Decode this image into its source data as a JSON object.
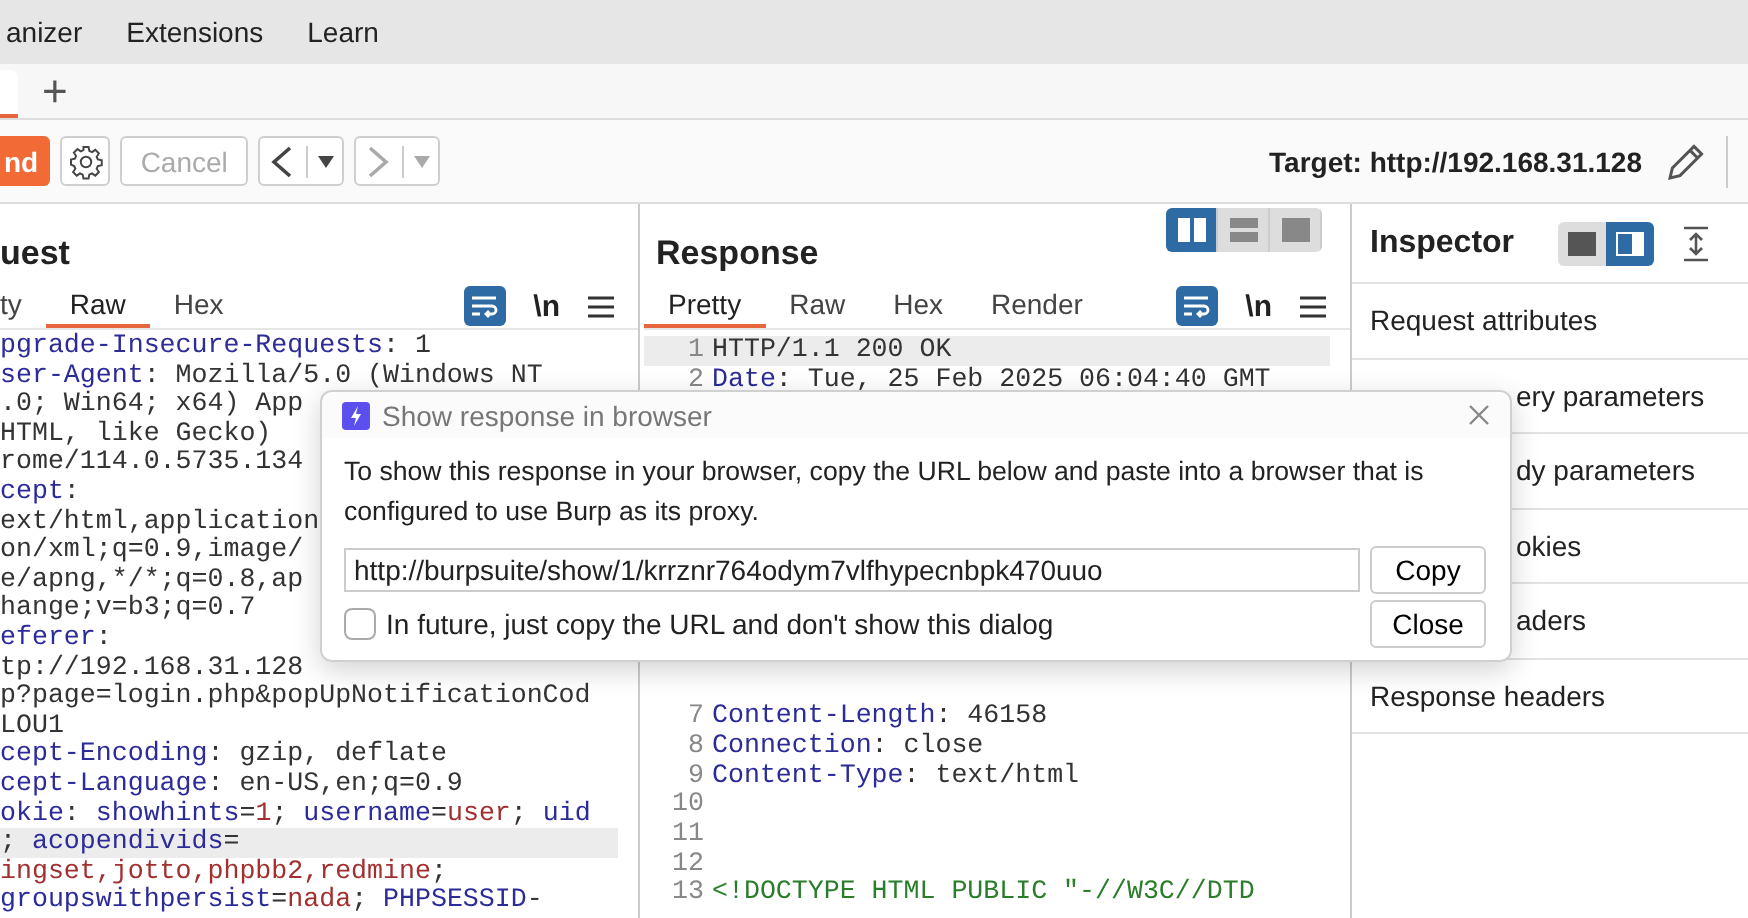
{
  "menu_bar": {
    "items": [
      "anizer",
      "Extensions",
      "Learn"
    ]
  },
  "tab_bar": {
    "add_label": "+"
  },
  "toolbar": {
    "send_label": "nd",
    "cancel": {
      "label": "Cancel",
      "disabled": true
    },
    "back": {
      "disabled": false
    },
    "forward": {
      "disabled": true
    },
    "target": "Target: http://192.168.31.128"
  },
  "request": {
    "title": "uest",
    "tabs": [
      {
        "label": "ty",
        "selected": false
      },
      {
        "label": "Raw",
        "selected": true
      },
      {
        "label": "Hex",
        "selected": false
      }
    ],
    "wrap": {
      "on": true
    },
    "newline_label": "\\n",
    "lines": [
      {
        "highlighted": false,
        "parts": [
          {
            "text": "pgrade-Insecure-Requests",
            "kind": "key"
          },
          {
            "text": ": 1",
            "kind": "plain"
          }
        ]
      },
      {
        "highlighted": false,
        "parts": [
          {
            "text": "ser-Agent",
            "kind": "key"
          },
          {
            "text": ": Mozilla/5.0 (Windows NT",
            "kind": "plain"
          }
        ]
      },
      {
        "highlighted": false,
        "parts": [
          {
            "text": ".0; Win64; x64) App",
            "kind": "plain"
          }
        ]
      },
      {
        "highlighted": false,
        "parts": [
          {
            "text": "HTML, like Gecko)",
            "kind": "plain"
          }
        ]
      },
      {
        "highlighted": false,
        "parts": [
          {
            "text": "rome/114.0.5735.134",
            "kind": "plain"
          }
        ]
      },
      {
        "highlighted": false,
        "parts": [
          {
            "text": "cept",
            "kind": "key"
          },
          {
            "text": ":",
            "kind": "plain"
          }
        ]
      },
      {
        "highlighted": false,
        "parts": [
          {
            "text": "ext/html,application",
            "kind": "plain"
          }
        ]
      },
      {
        "highlighted": false,
        "parts": [
          {
            "text": "on/xml;q=0.9,image/",
            "kind": "plain"
          }
        ]
      },
      {
        "highlighted": false,
        "parts": [
          {
            "text": "e/apng,*/*;q=0.8,ap",
            "kind": "plain"
          }
        ]
      },
      {
        "highlighted": false,
        "parts": [
          {
            "text": "hange;v=b3;q=0.7",
            "kind": "plain"
          }
        ]
      },
      {
        "highlighted": false,
        "parts": [
          {
            "text": "eferer",
            "kind": "key"
          },
          {
            "text": ":",
            "kind": "plain"
          }
        ]
      },
      {
        "highlighted": false,
        "parts": [
          {
            "text": "tp://192.168.31.128",
            "kind": "plain"
          }
        ]
      },
      {
        "highlighted": false,
        "parts": [
          {
            "text": "p?page=login.php&popUpNotificationCod",
            "kind": "plain"
          }
        ]
      },
      {
        "highlighted": false,
        "parts": [
          {
            "text": "LOU1",
            "kind": "plain"
          }
        ]
      },
      {
        "highlighted": false,
        "parts": [
          {
            "text": "cept-Encoding",
            "kind": "key"
          },
          {
            "text": ": gzip, deflate",
            "kind": "plain"
          }
        ]
      },
      {
        "highlighted": false,
        "parts": [
          {
            "text": "cept-Language",
            "kind": "key"
          },
          {
            "text": ": en-US,en;q=0.9",
            "kind": "plain"
          }
        ]
      },
      {
        "highlighted": false,
        "parts": [
          {
            "text": "okie",
            "kind": "key"
          },
          {
            "text": ": ",
            "kind": "plain"
          },
          {
            "text": "showhints",
            "kind": "key"
          },
          {
            "text": "=",
            "kind": "plain"
          },
          {
            "text": "1",
            "kind": "value"
          },
          {
            "text": "; ",
            "kind": "plain"
          },
          {
            "text": "username",
            "kind": "key"
          },
          {
            "text": "=",
            "kind": "plain"
          },
          {
            "text": "user",
            "kind": "value"
          },
          {
            "text": "; ",
            "kind": "plain"
          },
          {
            "text": "uid",
            "kind": "key"
          }
        ]
      },
      {
        "highlighted": true,
        "parts": [
          {
            "text": "; ",
            "kind": "plain"
          },
          {
            "text": "acopendivids",
            "kind": "key"
          },
          {
            "text": "=",
            "kind": "plain"
          }
        ]
      },
      {
        "highlighted": false,
        "parts": [
          {
            "text": "ingset,jotto,phpbb2,redmine",
            "kind": "value"
          },
          {
            "text": ";",
            "kind": "plain"
          }
        ]
      },
      {
        "highlighted": false,
        "parts": [
          {
            "text": "groupswithpersist",
            "kind": "key"
          },
          {
            "text": "=",
            "kind": "plain"
          },
          {
            "text": "nada",
            "kind": "value"
          },
          {
            "text": "; ",
            "kind": "plain"
          },
          {
            "text": "PHPSESSID",
            "kind": "key"
          },
          {
            "text": "-",
            "kind": "plain"
          }
        ]
      }
    ]
  },
  "response": {
    "title": "Response",
    "layout_modes": [
      {
        "kind": "columns",
        "selected": true
      },
      {
        "kind": "rows",
        "selected": false
      },
      {
        "kind": "single",
        "selected": false
      }
    ],
    "tabs": [
      {
        "label": "Pretty",
        "selected": true
      },
      {
        "label": "Raw",
        "selected": false
      },
      {
        "label": "Hex",
        "selected": false
      },
      {
        "label": "Render",
        "selected": false
      }
    ],
    "wrap": {
      "on": true
    },
    "newline_label": "\\n",
    "lines_top": [
      {
        "number": "1",
        "highlighted": true,
        "parts": [
          {
            "text": "HTTP/1.1 200 OK",
            "kind": "plain"
          }
        ]
      },
      {
        "number": "2",
        "highlighted": false,
        "parts": [
          {
            "text": "Date",
            "kind": "key"
          },
          {
            "text": ": Tue, 25 Feb 2025 06:04:40 GMT",
            "kind": "plain"
          }
        ]
      }
    ],
    "lines_bottom": [
      {
        "number": "7",
        "highlighted": false,
        "parts": [
          {
            "text": "Content-Length",
            "kind": "key"
          },
          {
            "text": ": 46158",
            "kind": "plain"
          }
        ]
      },
      {
        "number": "8",
        "highlighted": false,
        "parts": [
          {
            "text": "Connection",
            "kind": "key"
          },
          {
            "text": ": close",
            "kind": "plain"
          }
        ]
      },
      {
        "number": "9",
        "highlighted": false,
        "parts": [
          {
            "text": "Content-Type",
            "kind": "key"
          },
          {
            "text": ": text/html",
            "kind": "plain"
          }
        ]
      },
      {
        "number": "10",
        "highlighted": false
      },
      {
        "number": "11",
        "highlighted": false
      },
      {
        "number": "12",
        "highlighted": false
      },
      {
        "number": "13",
        "highlighted": false,
        "parts": [
          {
            "text": "<!DOCTYPE HTML PUBLIC \"-//W3C//DTD",
            "kind": "markup"
          }
        ]
      }
    ]
  },
  "inspector": {
    "title": "Inspector",
    "layout_modes": [
      {
        "kind": "single",
        "selected": false
      },
      {
        "kind": "side",
        "selected": true
      }
    ],
    "sections": [
      {
        "label": "Request attributes",
        "kind": "full"
      },
      {
        "label": "ery parameters",
        "kind": "covered"
      },
      {
        "label": "dy parameters",
        "kind": "covered"
      },
      {
        "label": "okies",
        "kind": "covered"
      },
      {
        "label": "aders",
        "kind": "covered"
      },
      {
        "label": "Response headers",
        "kind": "full"
      }
    ]
  },
  "dialog": {
    "title": "Show response in browser",
    "message": "To show this response in your browser, copy the URL below and paste into a browser that is configured to use Burp as its proxy.",
    "url": "http://burpsuite/show/1/krrznr764odym7vlfhypecnbpk470uuo",
    "copy_label": "Copy",
    "checkbox": {
      "label": "In future, just copy the URL and don't show this dialog",
      "checked": false
    },
    "close_label": "Close"
  }
}
